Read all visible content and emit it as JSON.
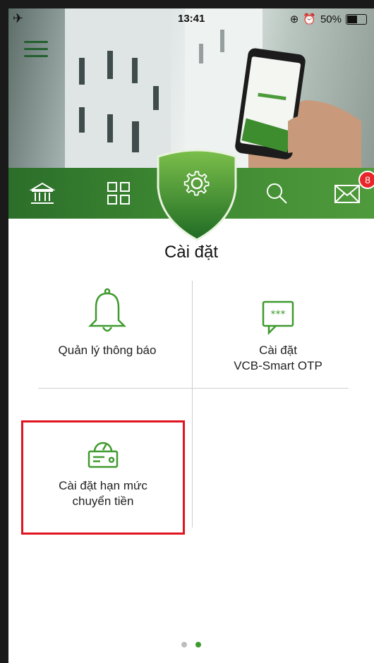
{
  "status_bar": {
    "time": "13:41",
    "battery": "50%",
    "airplane_icon": "airplane-icon",
    "alarm_icon": "alarm-icon"
  },
  "nav": {
    "items": [
      {
        "name": "bank",
        "icon": "bank-icon"
      },
      {
        "name": "apps",
        "icon": "grid-icon"
      },
      {
        "name": "settings",
        "icon": "gear-icon",
        "active": true
      },
      {
        "name": "search",
        "icon": "search-icon"
      },
      {
        "name": "messages",
        "icon": "mail-icon"
      }
    ],
    "mail_badge": "8"
  },
  "page": {
    "title": "Cài đặt"
  },
  "tiles": {
    "notification": {
      "line1": "Quản lý thông báo",
      "icon": "bell-icon"
    },
    "otp": {
      "line1": "Cài đặt",
      "line2": "VCB-Smart OTP",
      "icon": "message-otp-icon"
    },
    "limit": {
      "line1": "Cài đặt hạn mức",
      "line2": "chuyển tiền",
      "icon": "meter-card-icon"
    }
  },
  "pager": {
    "active_index": 1,
    "count": 2,
    "active_color": "#3f9a2e",
    "inactive_color": "#bdbdbd"
  },
  "colors": {
    "brand_green": "#3f8a32",
    "highlight_red": "#e0141f",
    "badge_red": "#e8262a"
  }
}
